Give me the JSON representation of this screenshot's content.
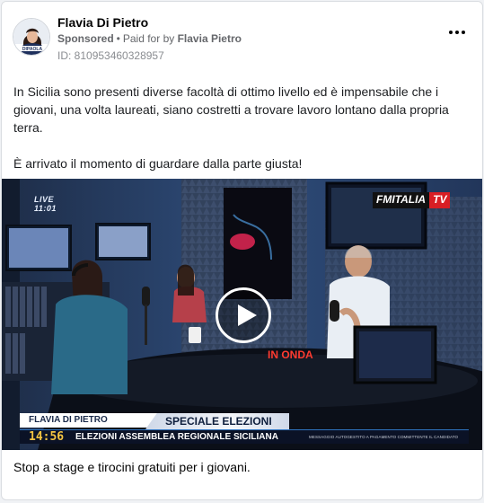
{
  "post": {
    "page_name": "Flavia Di Pietro",
    "sponsored_label": "Sponsored",
    "separator": "•",
    "paid_for_prefix": "Paid for by",
    "paid_for_name": "Flavia Pietro",
    "ad_id": "ID: 810953460328957",
    "more_icon": "more-options-icon",
    "body_paragraphs": [
      "In Sicilia sono presenti diverse facoltà di ottimo livello ed è impensabile che i giovani, una volta laureati, siano costretti a trovare lavoro lontano dalla propria terra.",
      "È arrivato il momento di guardare dalla parte giusta!"
    ],
    "caption": "Stop a stage e tirocini gratuiti per i giovani.",
    "avatar_logo_text": "DIPAOLA"
  },
  "video": {
    "play_icon": "play-icon",
    "live_label": "LIVE",
    "live_time": "11:01",
    "channel_logo_part1": "FMITALIA",
    "channel_logo_part2": "TV",
    "on_air_sign": "IN ONDA",
    "lower_third": {
      "name": "FLAVIA DI PIETRO",
      "topic": "SPECIALE ELEZIONI",
      "time": "14:56",
      "headline": "ELEZIONI ASSEMBLEA REGIONALE SICILIANA",
      "disclaimer": "MESSAGGIO AUTOGESTITO A PAGAMENTO COMMITTENTE IL CANDIDATO"
    }
  },
  "colors": {
    "card_bg": "#ffffff",
    "secondary_text": "#65676b",
    "channel_red": "#d81e24",
    "ticker_bg": "#0b1226"
  }
}
